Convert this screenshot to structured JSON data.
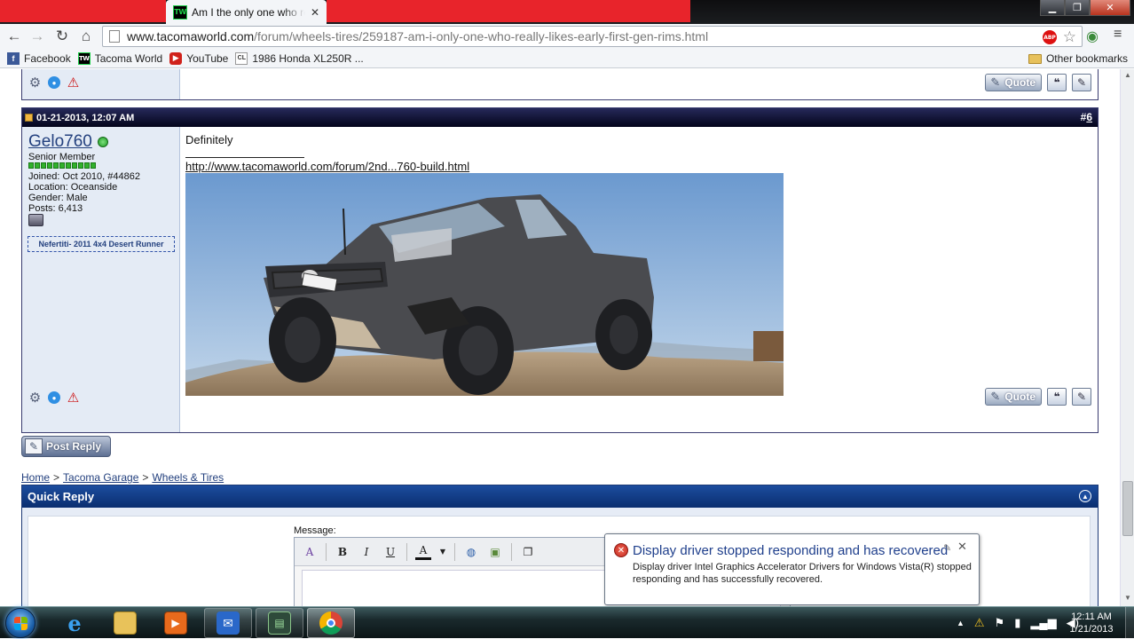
{
  "browser": {
    "tab_title": "Am I the only one who re",
    "tab_favicon_text": "TW",
    "url_host": "www.tacomaworld.com",
    "url_path": "/forum/wheels-tires/259187-am-i-only-one-who-really-likes-early-first-gen-rims.html",
    "abp_text": "ABP",
    "bookmarks": [
      {
        "label": "Facebook",
        "icon": "facebook-icon",
        "glyph": "f"
      },
      {
        "label": "Tacoma World",
        "icon": "tacomaworld-icon",
        "glyph": "TW"
      },
      {
        "label": "YouTube",
        "icon": "youtube-icon",
        "glyph": "▶"
      },
      {
        "label": "1986 Honda XL250R ...",
        "icon": "craigslist-icon",
        "glyph": "CL"
      }
    ],
    "other_bookmarks": "Other bookmarks"
  },
  "post": {
    "date": "01-21-2013, 12:07 AM",
    "number_hash": "#",
    "number": "6",
    "username": "Gelo760",
    "user_title": "Senior Member",
    "joined": "Joined: Oct 2010, #44862",
    "location": "Location: Oceanside",
    "gender": "Gender: Male",
    "posts": "Posts: 6,413",
    "vehicle_sig": "Nefertiti- 2011 4x4 Desert Runner",
    "message": "Definitely",
    "signature_link": "http://www.tacomaworld.com/forum/2nd...760-build.html",
    "quote_label": "Quote"
  },
  "post_reply_label": "Post Reply",
  "breadcrumb": [
    "Home",
    "Tacoma Garage",
    "Wheels & Tires"
  ],
  "breadcrumb_sep": ">",
  "quick_reply": {
    "title": "Quick Reply",
    "message_label": "Message:",
    "toolbar": [
      "B",
      "I",
      "U",
      "A"
    ]
  },
  "notification": {
    "title": "Display driver stopped responding and has recovered",
    "body": "Display driver Intel Graphics Accelerator Drivers for Windows Vista(R) stopped responding and has successfully recovered."
  },
  "taskbar": {
    "time": "12:11 AM",
    "date": "1/21/2013",
    "apps": [
      "internet-explorer",
      "file-explorer",
      "media-player",
      "messenger",
      "task-app",
      "chrome"
    ]
  },
  "colors": {
    "tab_red": "#e8242b",
    "post_header": "#03041a",
    "quick_reply_header": "#1c4d9e",
    "link": "#23407e"
  }
}
